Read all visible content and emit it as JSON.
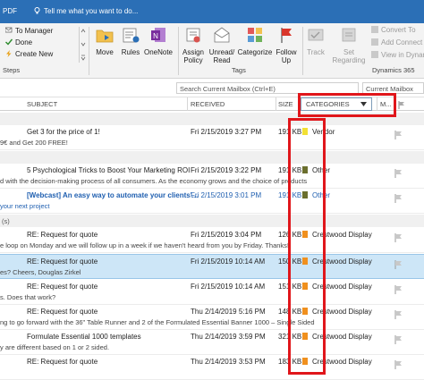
{
  "titlebar": {
    "left_text": "PDF",
    "tell_me": "Tell me what you want to do..."
  },
  "ribbon": {
    "quick_steps": [
      {
        "label": "To Manager",
        "icon": "to-manager-icon"
      },
      {
        "label": "Done",
        "icon": "checkmark-icon"
      },
      {
        "label": "Create New",
        "icon": "lightning-icon"
      }
    ],
    "steps_label": "Steps",
    "move": {
      "label": "Move"
    },
    "rules": {
      "label": "Rules"
    },
    "onenote": {
      "label": "OneNote"
    },
    "assign_policy": {
      "label1": "Assign",
      "label2": "Policy"
    },
    "unread_read": {
      "label1": "Unread/",
      "label2": "Read"
    },
    "categorize": {
      "label": "Categorize"
    },
    "follow_up": {
      "label1": "Follow",
      "label2": "Up"
    },
    "tags_label": "Tags",
    "track": {
      "label": "Track"
    },
    "set_regarding": {
      "label1": "Set",
      "label2": "Regarding"
    },
    "convert_to": "Convert To",
    "add_connection": "Add Connect",
    "view_in_dynamics": "View in Dynami",
    "dynamics_label": "Dynamics 365"
  },
  "search": {
    "placeholder": "Search Current Mailbox (Ctrl+E)",
    "scope": "Current Mailbox"
  },
  "columns": {
    "subject": "SUBJECT",
    "received": "RECEIVED",
    "size": "SIZE",
    "categories": "CATEGORIES",
    "mention": "M..."
  },
  "groups": [
    "",
    "",
    "(s)"
  ],
  "messages": [
    {
      "subject": "Get 3 for the price of 1!",
      "received": "Fri 2/15/2019 3:27 PM",
      "size": "191 KB",
      "category": "Vendor",
      "cat_color": "#f2e034",
      "preview": "9€ and Get 200 FREE!",
      "unread": false,
      "selected": false
    },
    {
      "subject": "5 Psychological Tricks to Boost Your Marketing ROI",
      "received": "Fri 2/15/2019 3:22 PM",
      "size": "191 KB",
      "category": "Other",
      "cat_color": "#6b6f2e",
      "preview": "d with the decision-making process of all consumers. As the economy grows and the choice of products",
      "unread": false,
      "selected": false
    },
    {
      "subject": "[Webcast] An easy way to automate your clients'...",
      "received": "Fri 2/15/2019 3:01 PM",
      "size": "191 KB",
      "category": "Other",
      "cat_color": "#6b6f2e",
      "preview": "your next project",
      "unread": true,
      "selected": false
    },
    {
      "subject": "RE: Request for quote",
      "received": "Fri 2/15/2019 3:04 PM",
      "size": "126 KB",
      "category": "Crestwood Display",
      "cat_color": "#f0901e",
      "preview": "e loop on Monday and we will follow up in a week if we haven't heard from you by Friday. Thanks!",
      "unread": false,
      "selected": false
    },
    {
      "subject": "RE: Request for quote",
      "received": "Fri 2/15/2019 10:14 AM",
      "size": "150 KB",
      "category": "Crestwood Display",
      "cat_color": "#f0901e",
      "preview": "es?  Cheers,  Douglas Zirkel",
      "unread": false,
      "selected": true
    },
    {
      "subject": "RE: Request for quote",
      "received": "Fri 2/15/2019 10:14 AM",
      "size": "151 KB",
      "category": "Crestwood Display",
      "cat_color": "#f0901e",
      "preview": "s.  Does that work?",
      "unread": false,
      "selected": false
    },
    {
      "subject": "RE: Request for quote",
      "received": "Thu 2/14/2019 5:16 PM",
      "size": "148 KB",
      "category": "Crestwood Display",
      "cat_color": "#f0901e",
      "preview": "ng to go forward with the 36\" Table Runner and 2 of the Formulated Essential Banner 1000 – Single Sided",
      "unread": false,
      "selected": false
    },
    {
      "subject": "Formulate Essential 1000 templates",
      "received": "Thu 2/14/2019 3:59 PM",
      "size": "321 KB",
      "category": "Crestwood Display",
      "cat_color": "#f0901e",
      "preview": "y are different based on 1 or 2 sided.",
      "unread": false,
      "selected": false
    },
    {
      "subject": "RE: Request for quote",
      "received": "Thu 2/14/2019 3:53 PM",
      "size": "183 KB",
      "category": "Crestwood Display",
      "cat_color": "#f0901e",
      "preview": "",
      "unread": false,
      "selected": false
    }
  ],
  "colors": {
    "titlebar": "#2b6fb6",
    "highlight": "#e0161b",
    "selected_row": "#cde6f7",
    "unread_text": "#1f5fb0"
  }
}
